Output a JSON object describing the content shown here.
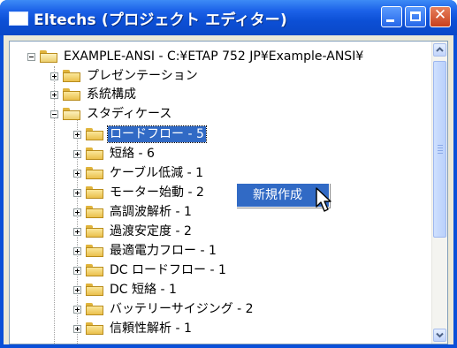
{
  "window": {
    "title": "Eltechs (プロジェクト エディター)"
  },
  "tree": {
    "root": {
      "label": "EXAMPLE-ANSI - C:¥ETAP 752 JP¥Example-ANSI¥",
      "expanded": true
    },
    "level1": [
      {
        "label": "プレゼンテーション",
        "expanded": false
      },
      {
        "label": "系統構成",
        "expanded": false
      },
      {
        "label": "スタディケース",
        "expanded": true
      }
    ],
    "study_cases": [
      {
        "label": "ロードフロー - 5",
        "selected": true
      },
      {
        "label": "短絡 - 6"
      },
      {
        "label": "ケーブル低減 - 1"
      },
      {
        "label": "モーター始動 - 2"
      },
      {
        "label": "高調波解析 - 1"
      },
      {
        "label": "過渡安定度 - 2"
      },
      {
        "label": "最適電力フロー - 1"
      },
      {
        "label": "DC ロードフロー - 1"
      },
      {
        "label": "DC 短絡 - 1"
      },
      {
        "label": "バッテリーサイジング - 2"
      },
      {
        "label": "信頼性解析 - 1"
      }
    ]
  },
  "context_menu": {
    "item": "新規作成"
  },
  "scrollbar": {
    "up_icon": "up-arrow-icon",
    "down_icon": "down-arrow-icon"
  },
  "colors": {
    "titlebar": "#0a50d8",
    "selection": "#316ac5",
    "close_button": "#c8401d"
  }
}
